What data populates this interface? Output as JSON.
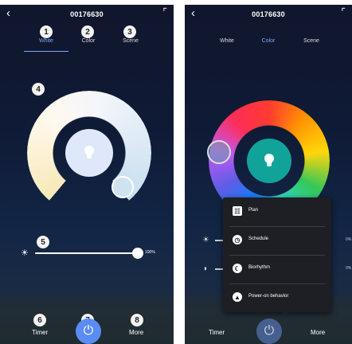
{
  "left": {
    "title": "00176630",
    "tabs": [
      "White",
      "Color",
      "Scene"
    ],
    "active_tab": "White",
    "brightness_percent": "100%",
    "bottom": {
      "timer": "Timer",
      "more": "More"
    },
    "badges": [
      "1",
      "2",
      "3",
      "4",
      "5",
      "6",
      "7",
      "8"
    ]
  },
  "right": {
    "title": "00176630",
    "tabs": [
      "White",
      "Color",
      "Scene"
    ],
    "active_tab": "Color",
    "slider_percent_1": "0%",
    "slider_percent_2": "0%",
    "bottom": {
      "timer": "Timer",
      "more": "More"
    },
    "menu": [
      {
        "label": "Plan",
        "icon": "plan-icon"
      },
      {
        "label": "Schedule",
        "icon": "clock-icon"
      },
      {
        "label": "Biorhythm",
        "icon": "biorhythm-icon"
      },
      {
        "label": "Power-on behavior",
        "icon": "power-behavior-icon"
      }
    ]
  },
  "colors": {
    "accent": "#7fa7ff",
    "power_button": "#5b8cf5",
    "color_center": "#11a39a"
  }
}
